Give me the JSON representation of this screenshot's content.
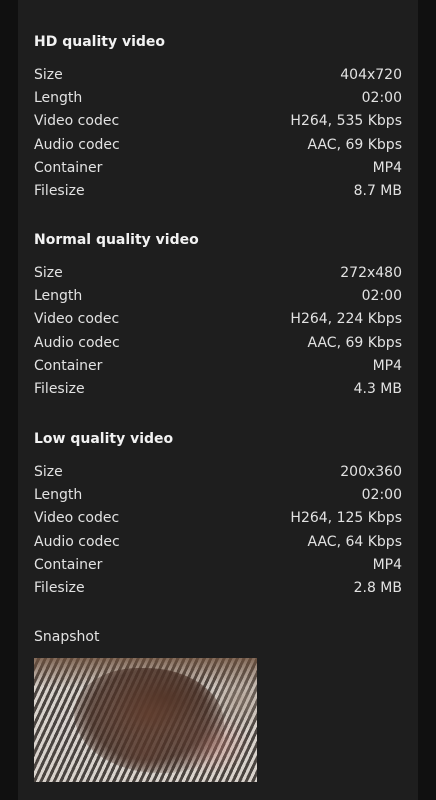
{
  "sections": [
    {
      "title": "HD quality video",
      "rows": [
        {
          "label": "Size",
          "value": "404x720"
        },
        {
          "label": "Length",
          "value": "02:00"
        },
        {
          "label": "Video codec",
          "value": "H264, 535 Kbps"
        },
        {
          "label": "Audio codec",
          "value": "AAC, 69 Kbps"
        },
        {
          "label": "Container",
          "value": "MP4"
        },
        {
          "label": "Filesize",
          "value": "8.7 MB"
        }
      ]
    },
    {
      "title": "Normal quality video",
      "rows": [
        {
          "label": "Size",
          "value": "272x480"
        },
        {
          "label": "Length",
          "value": "02:00"
        },
        {
          "label": "Video codec",
          "value": "H264, 224 Kbps"
        },
        {
          "label": "Audio codec",
          "value": "AAC, 69 Kbps"
        },
        {
          "label": "Container",
          "value": "MP4"
        },
        {
          "label": "Filesize",
          "value": "4.3 MB"
        }
      ]
    },
    {
      "title": "Low quality video",
      "rows": [
        {
          "label": "Size",
          "value": "200x360"
        },
        {
          "label": "Length",
          "value": "02:00"
        },
        {
          "label": "Video codec",
          "value": "H264, 125 Kbps"
        },
        {
          "label": "Audio codec",
          "value": "AAC, 64 Kbps"
        },
        {
          "label": "Container",
          "value": "MP4"
        },
        {
          "label": "Filesize",
          "value": "2.8 MB"
        }
      ]
    }
  ],
  "snapshot": {
    "label": "Snapshot"
  }
}
